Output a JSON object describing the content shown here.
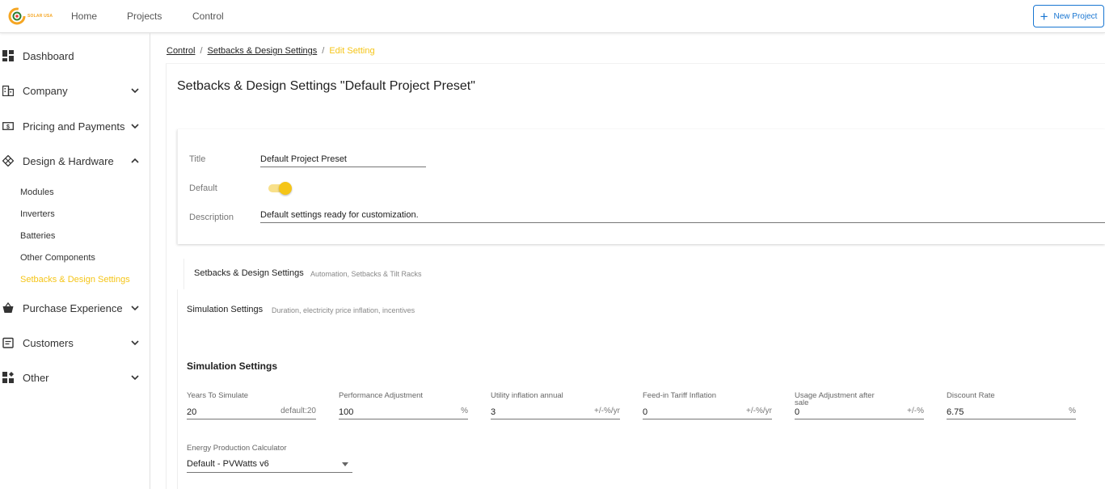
{
  "brand": {
    "logo_text": "SOLAR USA",
    "accent": "#f5a623",
    "highlight": "#f5c518",
    "link_blue": "#1976d2"
  },
  "topnav": {
    "home": "Home",
    "projects": "Projects",
    "control": "Control"
  },
  "header": {
    "new_project": "New Project"
  },
  "sidebar": {
    "dashboard": "Dashboard",
    "company": "Company",
    "pricing": "Pricing and Payments",
    "design": "Design & Hardware",
    "design_children": [
      "Modules",
      "Inverters",
      "Batteries",
      "Other Components",
      "Setbacks & Design Settings"
    ],
    "purchase": "Purchase Experience",
    "customers": "Customers",
    "other": "Other"
  },
  "breadcrumb": {
    "root": "Control",
    "parent": "Setbacks & Design Settings",
    "current": "Edit Setting",
    "separator": "/"
  },
  "page_title": "Setbacks & Design Settings \"Default Project Preset\"",
  "form": {
    "title_label": "Title",
    "title_value": "Default Project Preset",
    "default_label": "Default",
    "default_on": true,
    "description_label": "Description",
    "description_value": "Default settings ready for customization."
  },
  "sections": {
    "setbacks_title": "Setbacks & Design Settings",
    "setbacks_sub": "Automation, Setbacks & Tilt Racks",
    "simulation_title": "Simulation Settings",
    "simulation_sub": "Duration, electricity price inflation, incentives"
  },
  "simulation": {
    "heading": "Simulation Settings",
    "fields": [
      {
        "label": "Years To Simulate",
        "value": "20",
        "unit": "default:20"
      },
      {
        "label": "Performance Adjustment",
        "value": "100",
        "unit": "%"
      },
      {
        "label": "Utility inflation annual",
        "value": "3",
        "unit": "+/-%/yr"
      },
      {
        "label": "Feed-in Tariff Inflation",
        "value": "0",
        "unit": "+/-%/yr"
      },
      {
        "label": "Usage Adjustment after sale",
        "value": "0",
        "unit": "+/-%"
      },
      {
        "label": "Discount Rate",
        "value": "6.75",
        "unit": "%"
      }
    ],
    "calculator_label": "Energy Production Calculator",
    "calculator_value": "Default - PVWatts v6"
  }
}
